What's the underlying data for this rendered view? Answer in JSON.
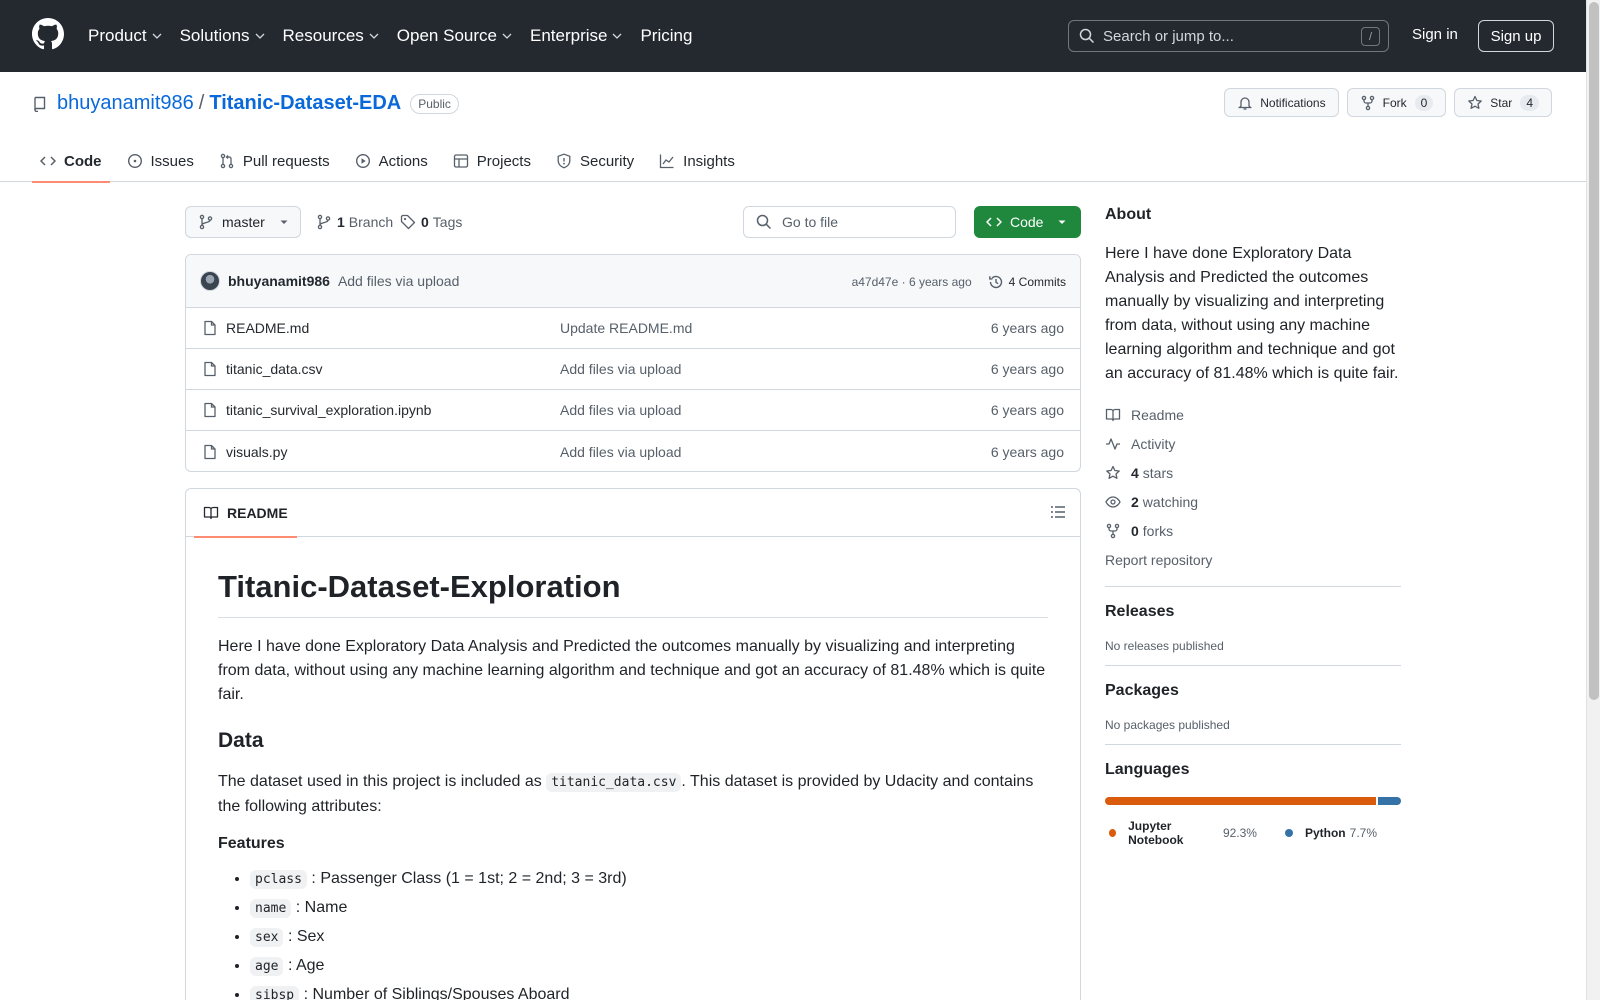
{
  "header": {
    "nav": [
      "Product",
      "Solutions",
      "Resources",
      "Open Source",
      "Enterprise",
      "Pricing"
    ],
    "search_placeholder": "Search or jump to...",
    "search_key": "/",
    "sign_in": "Sign in",
    "sign_up": "Sign up"
  },
  "repo": {
    "owner": "bhuyanamit986",
    "separator": "/",
    "name": "Titanic-Dataset-EDA",
    "visibility": "Public",
    "notifications_label": "Notifications",
    "fork_label": "Fork",
    "fork_count": "0",
    "star_label": "Star",
    "star_count": "4",
    "tabs": [
      "Code",
      "Issues",
      "Pull requests",
      "Actions",
      "Projects",
      "Security",
      "Insights"
    ]
  },
  "branchbar": {
    "branch": "master",
    "branch_count": "1",
    "branch_label": "Branch",
    "tag_count": "0",
    "tag_label": "Tags",
    "goto_placeholder": "Go to file",
    "code_button": "Code"
  },
  "commit": {
    "author": "bhuyanamit986",
    "message": "Add files via upload",
    "hash_time": "a47d47e · 6 years ago",
    "commits_label": "4 Commits"
  },
  "files": [
    {
      "name": "README.md",
      "message": "Update README.md",
      "date": "6 years ago"
    },
    {
      "name": "titanic_data.csv",
      "message": "Add files via upload",
      "date": "6 years ago"
    },
    {
      "name": "titanic_survival_exploration.ipynb",
      "message": "Add files via upload",
      "date": "6 years ago"
    },
    {
      "name": "visuals.py",
      "message": "Add files via upload",
      "date": "6 years ago"
    }
  ],
  "readme": {
    "tab_label": "README",
    "h1": "Titanic-Dataset-Exploration",
    "intro": "Here I have done Exploratory Data Analysis and Predicted the outcomes manually by visualizing and interpreting from data, without using any machine learning algorithm and technique and got an accuracy of 81.48% which is quite fair.",
    "data_heading": "Data",
    "data_text_1": "The dataset used in this project is included as ",
    "data_code": "titanic_data.csv",
    "data_text_2": ". This dataset is provided by Udacity and contains the following attributes:",
    "features_heading": "Features",
    "features": [
      {
        "code": "pclass",
        "text": ": Passenger Class (1 = 1st; 2 = 2nd; 3 = 3rd)"
      },
      {
        "code": "name",
        "text": ": Name"
      },
      {
        "code": "sex",
        "text": ": Sex"
      },
      {
        "code": "age",
        "text": ": Age"
      },
      {
        "code": "sibsp",
        "text": ": Number of Siblings/Spouses Aboard"
      }
    ]
  },
  "about": {
    "heading": "About",
    "description": "Here I have done Exploratory Data Analysis and Predicted the outcomes manually by visualizing and interpreting from data, without using any machine learning algorithm and technique and got an accuracy of 81.48% which is quite fair.",
    "readme": "Readme",
    "activity": "Activity",
    "stars_count": "4",
    "stars_label": "stars",
    "watching_count": "2",
    "watching_label": "watching",
    "forks_count": "0",
    "forks_label": "forks",
    "report": "Report repository"
  },
  "releases": {
    "heading": "Releases",
    "text": "No releases published"
  },
  "packages": {
    "heading": "Packages",
    "text": "No packages published"
  },
  "languages": {
    "heading": "Languages",
    "items": [
      {
        "name": "Jupyter Notebook",
        "percent": "92.3%",
        "value": 92.3,
        "color": "#DA5B0B"
      },
      {
        "name": "Python",
        "percent": "7.7%",
        "value": 7.7,
        "color": "#3572A5"
      }
    ]
  },
  "colors": {
    "header_bg": "#24292f",
    "link": "#0969da",
    "code_button": "#1f883d",
    "active_tab_underline": "#fd8c73"
  }
}
